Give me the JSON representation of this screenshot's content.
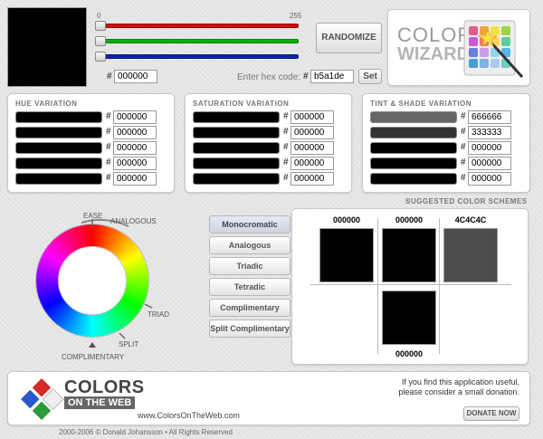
{
  "main_color": {
    "hex": "000000",
    "color": "#000000"
  },
  "sliders": {
    "min_label": "0",
    "max_label": "255",
    "channels": [
      {
        "name": "red",
        "value": 0,
        "color": "#cc1111"
      },
      {
        "name": "green",
        "value": 0,
        "color": "#11aa11"
      },
      {
        "name": "blue",
        "value": 0,
        "color": "#1122aa"
      }
    ]
  },
  "controls": {
    "randomize_label": "RANDOMIZE",
    "enter_hex_label": "Enter hex code:",
    "hex_entry_value": "b5a1de",
    "set_label": "Set",
    "hash": "#"
  },
  "logo": {
    "line1": "COLOR",
    "line2": "WIZARD"
  },
  "variations": [
    {
      "title": "HUE VARIATION",
      "rows": [
        "000000",
        "000000",
        "000000",
        "000000",
        "000000"
      ],
      "colors": [
        "#000000",
        "#000000",
        "#000000",
        "#000000",
        "#000000"
      ]
    },
    {
      "title": "SATURATION VARIATION",
      "rows": [
        "000000",
        "000000",
        "000000",
        "000000",
        "000000"
      ],
      "colors": [
        "#000000",
        "#000000",
        "#000000",
        "#000000",
        "#000000"
      ]
    },
    {
      "title": "TINT & SHADE VARIATION",
      "rows": [
        "666666",
        "333333",
        "000000",
        "000000",
        "000000"
      ],
      "colors": [
        "#666666",
        "#333333",
        "#000000",
        "#000000",
        "#000000"
      ]
    }
  ],
  "wheel": {
    "labels": {
      "ease": "EASE",
      "analogous": "ANALOGOUS",
      "triad": "TRIAD",
      "split": "SPLIT",
      "complimentary": "COMPLIMENTARY"
    }
  },
  "schemes": {
    "title": "SUGGESTED COLOR SCHEMES",
    "buttons": [
      "Monocromatic",
      "Analogous",
      "Triadic",
      "Tetradic",
      "Complimentary",
      "Split Complimentary"
    ],
    "active_index": 0,
    "top": [
      {
        "label": "000000",
        "color": "#000000"
      },
      {
        "label": "000000",
        "color": "#000000"
      },
      {
        "label": "4C4C4C",
        "color": "#4c4c4c"
      }
    ],
    "bottom": {
      "label": "000000",
      "color": "#000000"
    }
  },
  "footer": {
    "brand_line1": "COLORS",
    "brand_line2": "ON THE WEB",
    "brand_small": "· · · · · · · · · · · ·",
    "url": "www.ColorsOnTheWeb.com",
    "donate_text_1": "If you find this application useful,",
    "donate_text_2": "please consider a small donation.",
    "donate_label": "DONATE NOW",
    "copyright": "2000-2006 © Donald Johansson • All Rights Reserved"
  }
}
